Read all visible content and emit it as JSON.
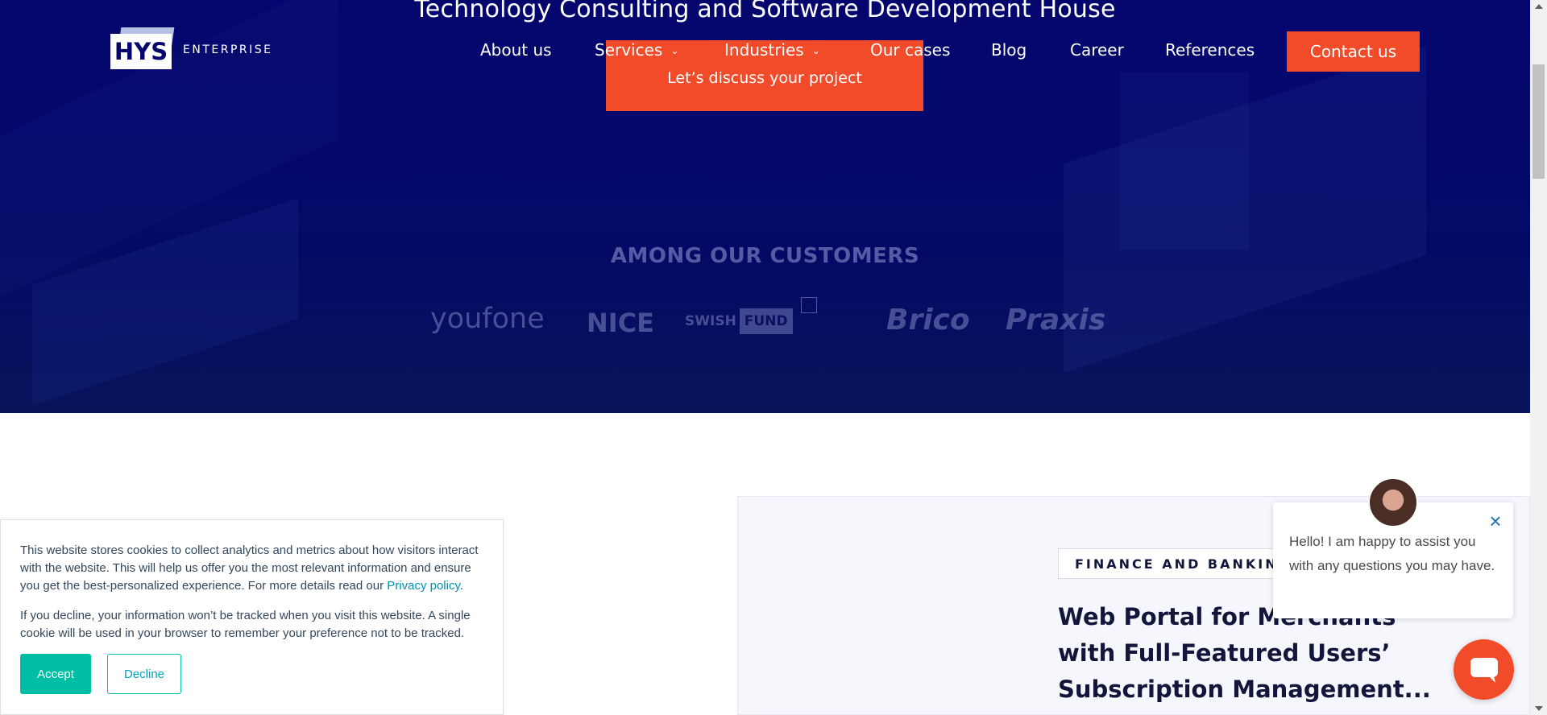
{
  "hero": {
    "title": "Technology Consulting and Software Development House",
    "cta_label": "Let’s discuss your project"
  },
  "logo": {
    "mark": "HYS",
    "text": "ENTERPRISE"
  },
  "nav": {
    "items": [
      {
        "label": "About us"
      },
      {
        "label": "Services",
        "has_dropdown": true
      },
      {
        "label": "Industries",
        "has_dropdown": true
      },
      {
        "label": "Our cases"
      },
      {
        "label": "Blog"
      },
      {
        "label": "Career"
      },
      {
        "label": "References"
      }
    ],
    "contact_label": "Contact us"
  },
  "customers": {
    "title": "AMONG OUR CUSTOMERS",
    "logos": [
      "youfone",
      "NICE",
      "SWISH",
      "FUND",
      "Brico",
      "Praxis"
    ]
  },
  "case": {
    "badge": "FINANCE AND BANKING",
    "title": "Web Portal for Merchants with Full-Featured Users’ Subscription Management..."
  },
  "cookie": {
    "p1": "This website stores cookies to collect analytics and metrics about how visitors interact with the website. This will help us offer you the most relevant information and ensure you get the best-personalized experience. For more details read our ",
    "privacy_link": "Privacy policy",
    "p1_end": ".",
    "p2": "If you decline, your information won’t be tracked when you visit this website. A single cookie will be used in your browser to remember your preference not to be tracked.",
    "accept": "Accept",
    "decline": "Decline"
  },
  "chat": {
    "message": "Hello! I am happy to assist you with any questions you may have.",
    "close_glyph": "×"
  },
  "colors": {
    "hero_bg": "#04066e",
    "accent": "#f24b2a",
    "cookie_accent": "#00bda5"
  }
}
